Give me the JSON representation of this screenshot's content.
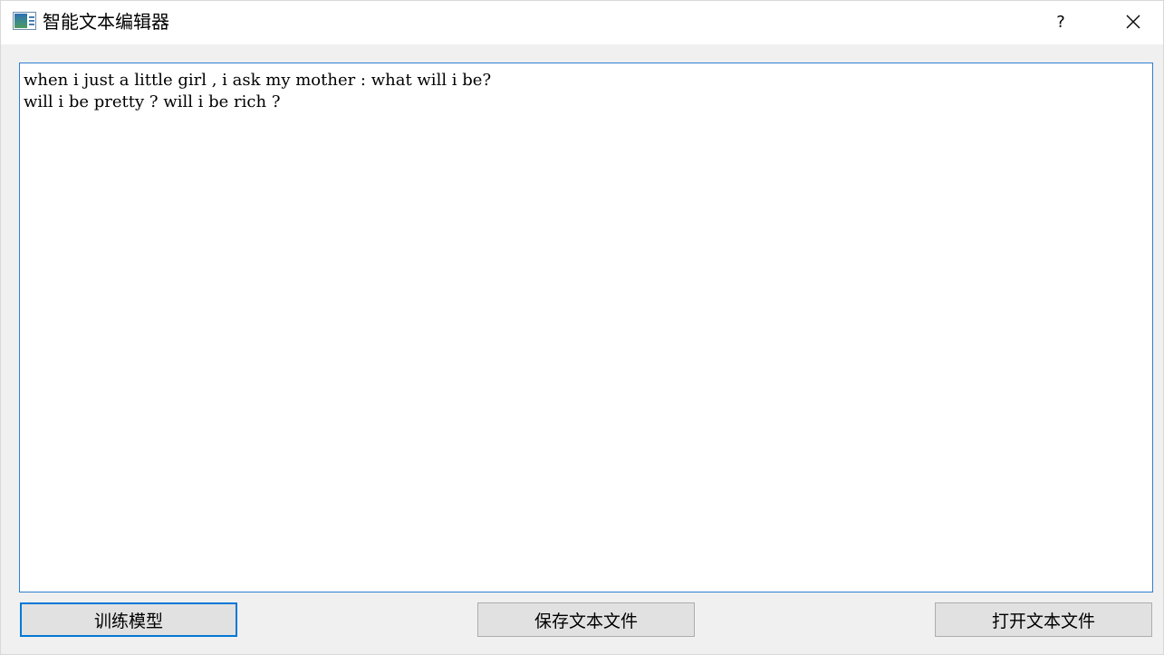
{
  "window": {
    "title": "智能文本编辑器",
    "help_label": "?",
    "accent_color": "#0078d7"
  },
  "icons": {
    "app": "app-window-icon",
    "close": "close-icon"
  },
  "editor": {
    "lines": [
      "when i just a little girl , i ask my mother : what will i be?",
      "will i be pretty ? will i be rich ?"
    ]
  },
  "buttons": {
    "train": "训练模型",
    "save": "保存文本文件",
    "open": "打开文本文件"
  }
}
